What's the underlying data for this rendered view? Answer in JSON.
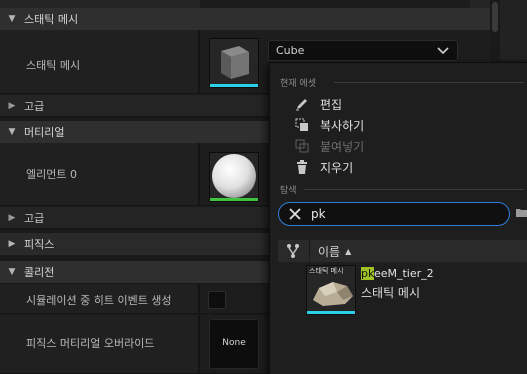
{
  "details": {
    "categories": [
      {
        "title": "스태틱 메시",
        "expanded": true
      },
      {
        "title": "머티리얼",
        "expanded": true
      },
      {
        "title": "피직스",
        "expanded": false
      },
      {
        "title": "콜리전",
        "expanded": true
      }
    ],
    "static_mesh": {
      "label": "스태틱 메시",
      "value": "Cube",
      "advanced": "고급"
    },
    "material": {
      "element_label": "엘리먼트 0",
      "advanced": "고급"
    },
    "collision": {
      "simulation_hit_label": "시뮬레이션 중 히트 이벤트 생성",
      "phys_material_label": "피직스 머티리얼 오버라이드",
      "phys_material_value": "None"
    }
  },
  "popup": {
    "current_asset_header": "현재 에셋",
    "actions": [
      {
        "label": "편집",
        "icon": "pencil-icon",
        "enabled": true
      },
      {
        "label": "복사하기",
        "icon": "copy-icon",
        "enabled": true
      },
      {
        "label": "붙여넣기",
        "icon": "paste-icon",
        "enabled": false
      },
      {
        "label": "지우기",
        "icon": "trash-icon",
        "enabled": true
      }
    ],
    "browse_header": "탐색",
    "search": {
      "value": "pk"
    },
    "list": {
      "column_name": "이름",
      "items": [
        {
          "thumb_caption": "스태틱 메시",
          "name_highlight": "pk",
          "name_rest": "eeM_tier_2",
          "type": "스태틱 메시"
        }
      ]
    }
  },
  "colors": {
    "static_mesh_strip": "#2ad0e8",
    "material_strip": "#3fc43f",
    "search_border": "#2f7ed8",
    "highlight": "#9fc326"
  }
}
